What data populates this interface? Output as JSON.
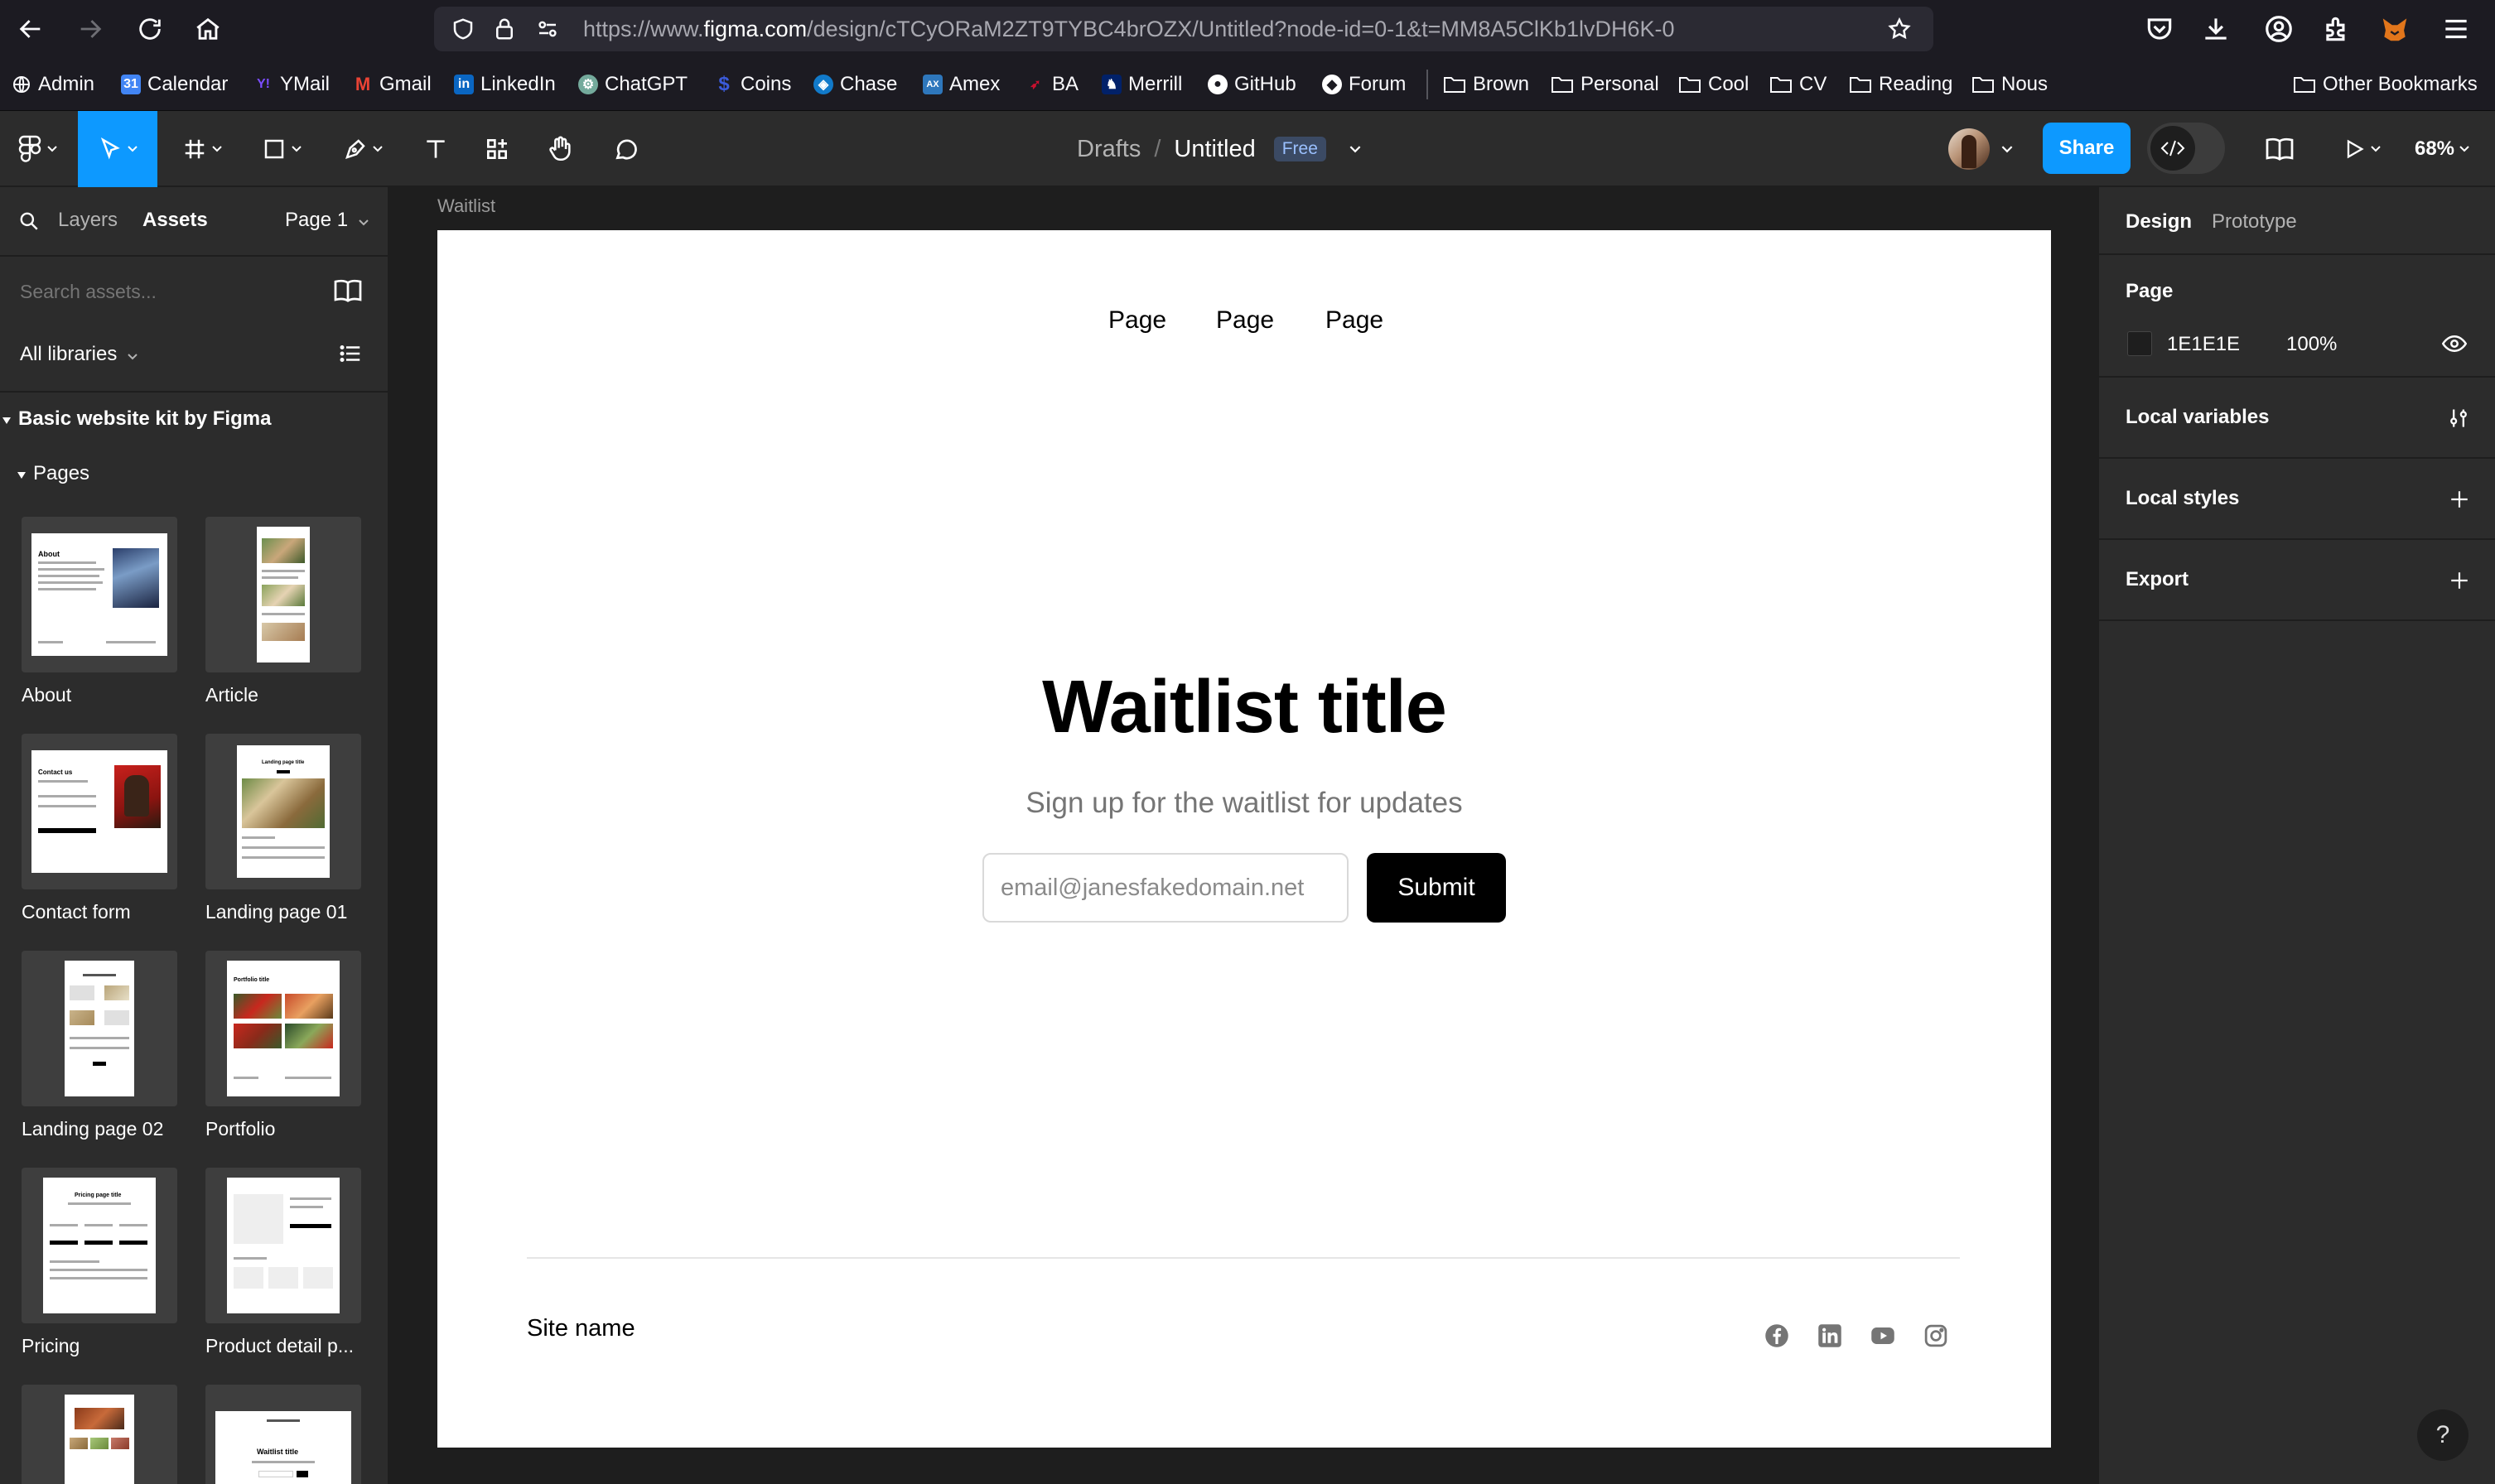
{
  "browser": {
    "url_prefix": "https://www.",
    "url_domain": "figma.com",
    "url_path": "/design/cTCyORaM2ZT9TYBC4brOZX/Untitled?node-id=0-1&t=MM8A5ClKb1lvDH6K-0",
    "bookmarks": [
      {
        "label": "Admin",
        "icon": "globe-icon",
        "color": "#cfcfd8"
      },
      {
        "label": "Calendar",
        "icon": "calendar-icon",
        "color": "#4285f4"
      },
      {
        "label": "YMail",
        "icon": "yahoo-icon",
        "color": "#6001d2"
      },
      {
        "label": "Gmail",
        "icon": "gmail-icon",
        "color": "#ea4335"
      },
      {
        "label": "LinkedIn",
        "icon": "linkedin-icon",
        "color": "#0a66c2"
      },
      {
        "label": "ChatGPT",
        "icon": "chatgpt-icon",
        "color": "#74aa9c"
      },
      {
        "label": "Coins",
        "icon": "coins-icon",
        "color": "#3b5bdb"
      },
      {
        "label": "Chase",
        "icon": "chase-icon",
        "color": "#117aca"
      },
      {
        "label": "Amex",
        "icon": "amex-icon",
        "color": "#2e77bc"
      },
      {
        "label": "BA",
        "icon": "ba-icon",
        "color": "#c8102e"
      },
      {
        "label": "Merrill",
        "icon": "merrill-icon",
        "color": "#012169"
      },
      {
        "label": "GitHub",
        "icon": "github-icon",
        "color": "#ffffff"
      },
      {
        "label": "Forum",
        "icon": "forum-icon",
        "color": "#ffffff"
      }
    ],
    "bookmark_folders": [
      "Brown",
      "Personal",
      "Cool",
      "CV",
      "Reading",
      "Nous"
    ],
    "other_bookmarks": "Other Bookmarks"
  },
  "toolbar": {
    "breadcrumb_parent": "Drafts",
    "breadcrumb_sep": "/",
    "file_name": "Untitled",
    "plan_badge": "Free",
    "share_label": "Share",
    "zoom": "68%"
  },
  "left_panel": {
    "tab_layers": "Layers",
    "tab_assets": "Assets",
    "page_selector": "Page 1",
    "search_placeholder": "Search assets...",
    "libraries_filter": "All libraries",
    "library_name": "Basic website kit by Figma",
    "section": "Pages",
    "assets": [
      "About",
      "Article",
      "Contact form",
      "Landing page 01",
      "Landing page 02",
      "Portfolio",
      "Pricing",
      "Product detail p..."
    ]
  },
  "canvas": {
    "frame_label": "Waitlist",
    "nav_links": [
      "Page",
      "Page",
      "Page"
    ],
    "title": "Waitlist title",
    "subtitle": "Sign up for the waitlist for updates",
    "email_placeholder": "email@janesfakedomain.net",
    "submit_label": "Submit",
    "site_name": "Site name",
    "social_icons": [
      "facebook-icon",
      "linkedin-icon",
      "youtube-icon",
      "instagram-icon"
    ]
  },
  "right_panel": {
    "tab_design": "Design",
    "tab_prototype": "Prototype",
    "page_section": "Page",
    "page_color": "1E1E1E",
    "page_opacity": "100%",
    "local_variables": "Local variables",
    "local_styles": "Local styles",
    "export": "Export"
  }
}
